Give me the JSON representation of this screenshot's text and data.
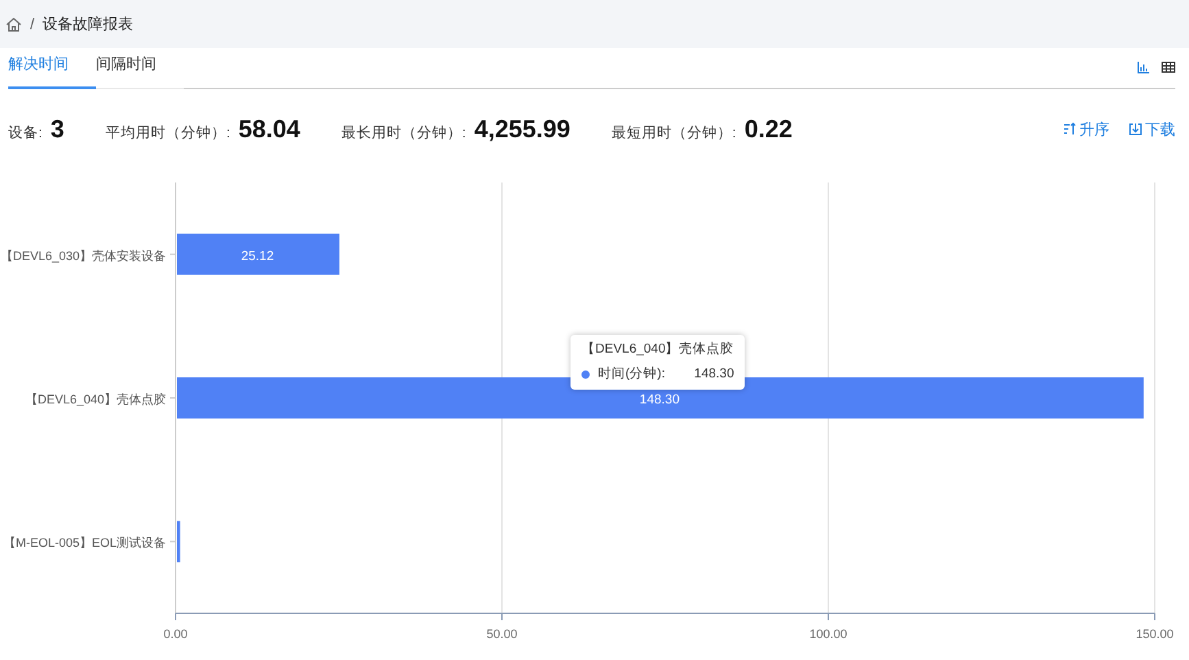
{
  "breadcrumb": {
    "separator": "/",
    "current": "设备故障报表"
  },
  "tabs": [
    {
      "label": "解决时间",
      "selected": true
    },
    {
      "label": "间隔时间",
      "selected": false
    }
  ],
  "views": [
    {
      "kind": "chart",
      "selected": true
    },
    {
      "kind": "table",
      "selected": false
    }
  ],
  "stats": [
    {
      "label": "设备:",
      "value": "3"
    },
    {
      "label": "平均用时（分钟）:",
      "value": "58.04"
    },
    {
      "label": "最长用时（分钟）:",
      "value": "4,255.99"
    },
    {
      "label": "最短用时（分钟）:",
      "value": "0.22"
    }
  ],
  "actions": [
    {
      "kind": "sort",
      "label": "升序"
    },
    {
      "kind": "download",
      "label": "下载"
    }
  ],
  "chart": {
    "chart_data": {
      "type": "bar",
      "orientation": "horizontal",
      "categories": [
        "【DEVL6_030】壳体安装设备",
        "【DEVL6_040】壳体点胶",
        "【M-EOL-005】EOL测试设备"
      ],
      "series": [
        {
          "name": "时间(分钟)",
          "color": "#5081f5",
          "values": [
            25.1,
            148.3,
            0.7
          ]
        }
      ],
      "xlim": [
        0,
        150
      ],
      "xticks": [
        {
          "value": 0,
          "label": "0.00"
        },
        {
          "value": 50,
          "label": "50.00"
        },
        {
          "value": 100,
          "label": "100.00"
        },
        {
          "value": 150,
          "label": "150.00"
        }
      ],
      "value_labels": [
        "25.12",
        "148.30",
        null
      ]
    },
    "tooltip": {
      "title": "【DEVL6_040】壳体点胶",
      "name_suffix": ":",
      "value": "148.30"
    }
  }
}
